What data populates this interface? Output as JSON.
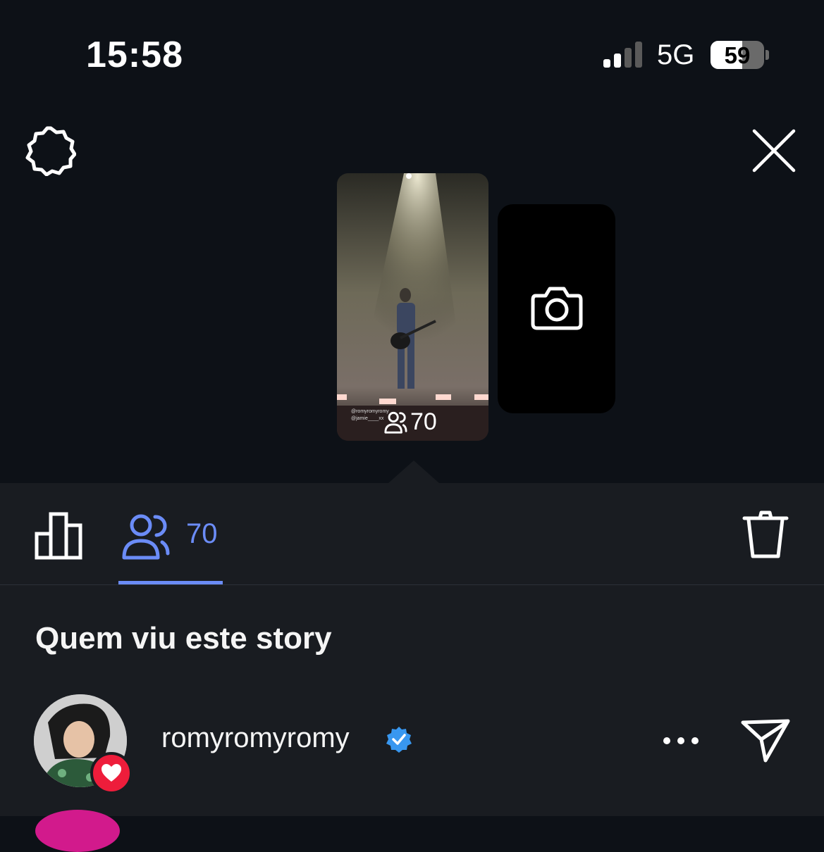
{
  "status_bar": {
    "time": "15:58",
    "network": "5G",
    "battery": "59",
    "battery_level": 0.59,
    "signal_bars": 2
  },
  "top_bar": {
    "settings_icon": "gear-icon",
    "close_icon": "close-icon"
  },
  "story": {
    "mention_1": "@romyromyromy",
    "mention_2": "@jamie____xx",
    "viewers_count": "70"
  },
  "new_story": {
    "icon": "camera-icon"
  },
  "tabs": {
    "insights_icon": "bar-chart-icon",
    "viewers_icon": "viewers-icon",
    "viewers_count": "70",
    "delete_icon": "trash-icon"
  },
  "section_title": "Quem viu este story",
  "viewers": [
    {
      "username": "romyromyromy",
      "verified": true,
      "liked": true
    }
  ],
  "colors": {
    "accent": "#6b8cf7",
    "like": "#ee1d3b",
    "verified": "#3897f0"
  }
}
